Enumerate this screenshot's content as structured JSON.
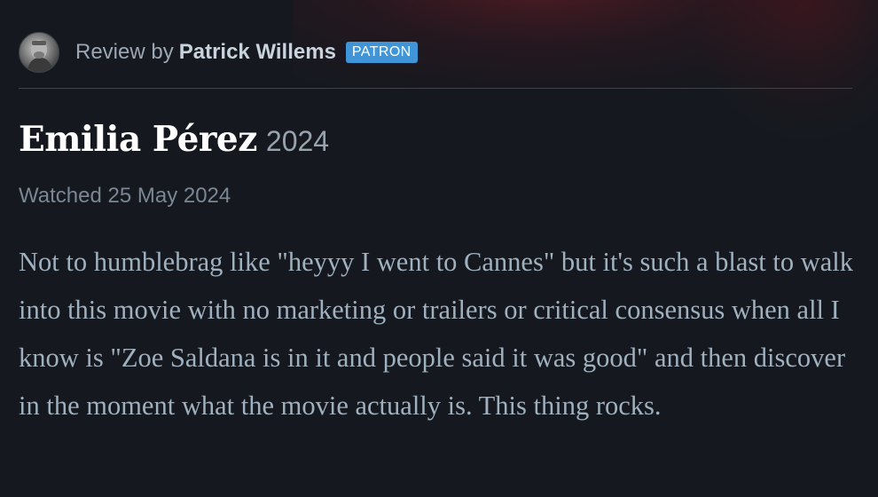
{
  "review": {
    "byline_prefix": "Review by",
    "author": "Patrick Willems",
    "badge": "PATRON",
    "film_title": "Emilia Pérez",
    "film_year": "2024",
    "watched": "Watched 25 May 2024",
    "body": "Not to humblebrag like \"heyyy I went to Cannes\" but it's such a blast to walk into this movie with no marketing or trailers or critical consensus when all I know is \"Zoe Saldana is in it and people said it was good\" and then discover in the moment what the movie actually is. This thing rocks."
  },
  "colors": {
    "background": "#15191f",
    "badge": "#3f95d8",
    "title": "#ffffff",
    "body_text": "#9fb0bf"
  }
}
